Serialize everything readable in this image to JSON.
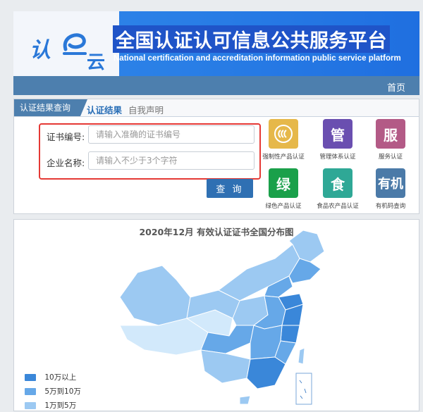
{
  "header": {
    "logo_text": "认",
    "logo_yun": "云",
    "title": "全国认证认可信息公共服务平台",
    "subtitle": "National certification and accreditation information public service platform"
  },
  "nav": {
    "home": "首页"
  },
  "search": {
    "tabs": [
      "认证结果查询",
      "认证结果",
      "自我声明"
    ],
    "cert_label": "证书编号:",
    "cert_placeholder": "请输入准确的证书编号",
    "company_label": "企业名称:",
    "company_placeholder": "请输入不少于3个字符",
    "query_button": "查 询"
  },
  "categories": [
    {
      "glyph": "(((",
      "label": "强制性产品认证",
      "color": "#e6b84a"
    },
    {
      "glyph": "管",
      "label": "管理体系认证",
      "color": "#6a4fb0"
    },
    {
      "glyph": "服",
      "label": "服务认证",
      "color": "#b35a86"
    },
    {
      "glyph": "绿",
      "label": "绿色产品认证",
      "color": "#1aa04a"
    },
    {
      "glyph": "食",
      "label": "食品农产品认证",
      "color": "#2fa896"
    },
    {
      "glyph": "有机",
      "label": "有机码查询",
      "color": "#4b7aa8"
    }
  ],
  "map": {
    "title": "2020年12月  有效认证证书全国分布图",
    "legend": [
      {
        "label": "10万以上",
        "color": "#3a87d9"
      },
      {
        "label": "5万到10万",
        "color": "#66a8e8"
      },
      {
        "label": "1万到5万",
        "color": "#9cc9f2"
      }
    ]
  }
}
